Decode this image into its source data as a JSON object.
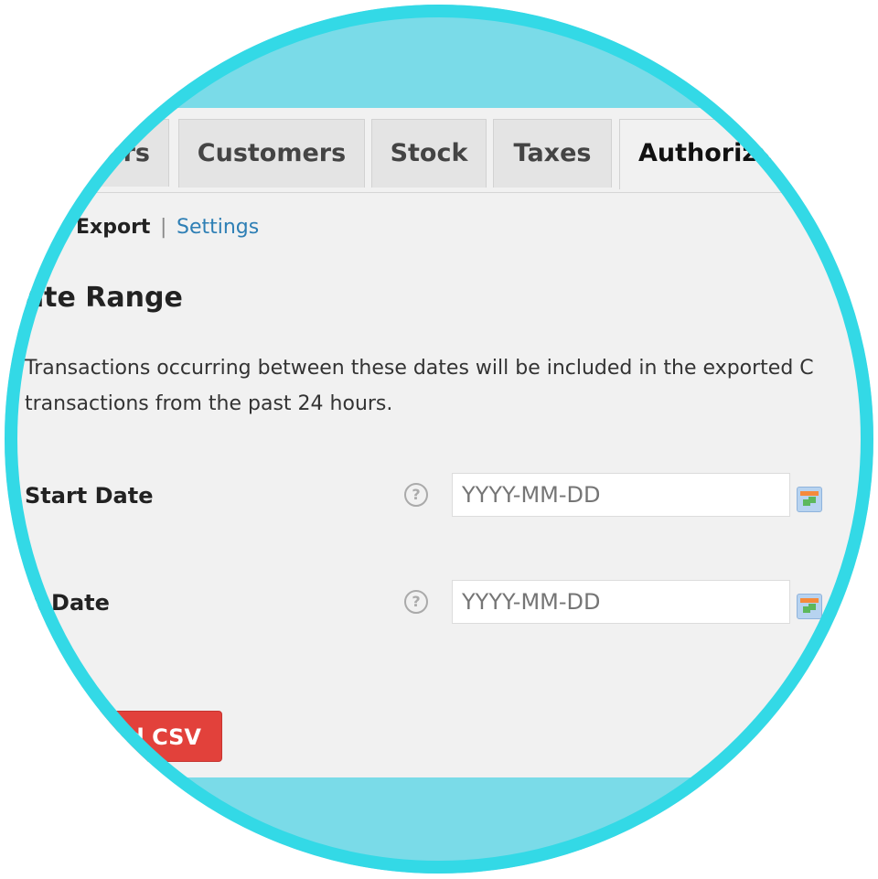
{
  "colors": {
    "ring": "#33d9e6",
    "ring_fill": "#7adbe8",
    "accent_button": "#e2413b",
    "link": "#2e7fb5"
  },
  "tabs": [
    {
      "label": "Orders",
      "active": false
    },
    {
      "label": "Customers",
      "active": false
    },
    {
      "label": "Stock",
      "active": false
    },
    {
      "label": "Taxes",
      "active": false
    },
    {
      "label": "Authorize",
      "active": true
    }
  ],
  "subnav": {
    "current": "Export",
    "separator": "|",
    "link": "Settings"
  },
  "section": {
    "title": "Date Range",
    "description_line1": "Transactions occurring between these dates will be included in the exported C",
    "description_line2": "transactions from the past 24 hours."
  },
  "fields": [
    {
      "label": "Start Date",
      "placeholder": "YYYY-MM-DD",
      "help_icon": "question-circle-icon",
      "picker_icon": "calendar-icon"
    },
    {
      "label": "End Date",
      "placeholder": "YYYY-MM-DD",
      "help_icon": "question-circle-icon",
      "picker_icon": "calendar-icon"
    }
  ],
  "button": {
    "label": "Download CSV"
  }
}
